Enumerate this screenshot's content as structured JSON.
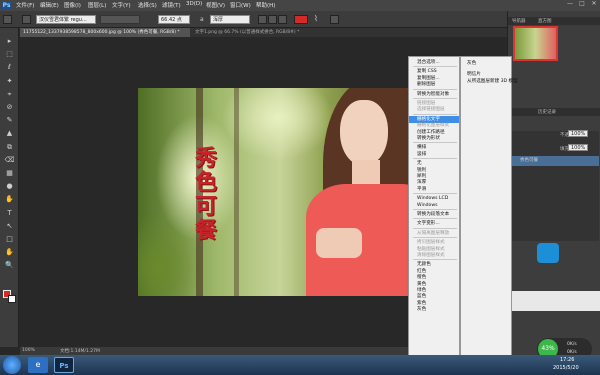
{
  "app": {
    "logo": "Ps"
  },
  "menubar": {
    "items": [
      "文件(F)",
      "编辑(E)",
      "图像(I)",
      "图层(L)",
      "文字(Y)",
      "选择(S)",
      "滤镜(T)",
      "3D(D)",
      "视图(V)",
      "窗口(W)",
      "帮助(H)"
    ]
  },
  "window_controls": {
    "minimize": "—",
    "restore": "□",
    "close": "✕"
  },
  "options": {
    "font_family": "汉仪雪君体繁",
    "font_style": "regu...",
    "font_size": "66.42 点",
    "antialias": "a",
    "antialias_mode": "浑厚",
    "text_color": "#d42a2a"
  },
  "tabs": [
    {
      "label": "11755122_1337938598578_800x600.jpg @ 100% (秀色可餐, RGB/8) *",
      "active": true
    },
    {
      "label": "文字1.png @ 66.7% (以普通样式拼合, RGB/8#) *",
      "active": false
    }
  ],
  "toolbar": {
    "tools": [
      "▸",
      "⬚",
      "ℓ",
      "✦",
      "⌖",
      "⊘",
      "✎",
      "▲",
      "⧉",
      "⌫",
      "▦",
      "●",
      "✋",
      "T",
      "↖",
      "□",
      "✋",
      "🔍"
    ]
  },
  "calligraphy": {
    "text": "秀色可餐"
  },
  "statusbar": {
    "zoom": "100%",
    "doc": "文档:1.14M/1.27M"
  },
  "navigator": {
    "tab1": "导航器",
    "tab2": "直方图"
  },
  "history": {
    "tab1": "历史记录"
  },
  "layers": {
    "opacity_label": "不透明度:",
    "opacity_value": "100%",
    "fill_label": "填充:",
    "fill_value": "100%",
    "rows": [
      "秀色可餐"
    ]
  },
  "context_menu": {
    "items": [
      {
        "label": "混合选项...",
        "disabled": false
      },
      {
        "sep": true
      },
      {
        "label": "复制 CSS",
        "disabled": false
      },
      {
        "label": "复制图层...",
        "disabled": false
      },
      {
        "label": "删除图层",
        "disabled": false
      },
      {
        "sep": true
      },
      {
        "label": "转换为智能对象",
        "disabled": false
      },
      {
        "sep": true
      },
      {
        "label": "链接图层",
        "disabled": true
      },
      {
        "label": "选择链接图层",
        "disabled": true
      },
      {
        "sep": true
      },
      {
        "label": "栅格化文字",
        "disabled": false,
        "highlight": true
      },
      {
        "label": "栅格化图层样式",
        "disabled": true
      },
      {
        "label": "创建工作路径",
        "disabled": false
      },
      {
        "label": "转换为形状",
        "disabled": false
      },
      {
        "sep": true
      },
      {
        "label": "横排",
        "disabled": false
      },
      {
        "label": "竖排",
        "disabled": false
      },
      {
        "sep": true
      },
      {
        "label": "无",
        "disabled": false
      },
      {
        "label": "锐利",
        "disabled": false
      },
      {
        "label": "犀利",
        "disabled": false
      },
      {
        "label": "浑厚",
        "disabled": false
      },
      {
        "label": "平滑",
        "disabled": false
      },
      {
        "sep": true
      },
      {
        "label": "Windows LCD",
        "disabled": false
      },
      {
        "label": "Windows",
        "disabled": false
      },
      {
        "sep": true
      },
      {
        "label": "转换为段落文本",
        "disabled": false
      },
      {
        "sep": true
      },
      {
        "label": "文字变形...",
        "disabled": false
      },
      {
        "sep": true
      },
      {
        "label": "从隔离图层释放",
        "disabled": true
      },
      {
        "sep": true
      },
      {
        "label": "拷贝图层样式",
        "disabled": true
      },
      {
        "label": "粘贴图层样式",
        "disabled": true
      },
      {
        "label": "清除图层样式",
        "disabled": true
      },
      {
        "sep": true
      },
      {
        "label": "无颜色",
        "disabled": false
      },
      {
        "label": "红色",
        "disabled": false
      },
      {
        "label": "橙色",
        "disabled": false
      },
      {
        "label": "黄色",
        "disabled": false
      },
      {
        "label": "绿色",
        "disabled": false
      },
      {
        "label": "蓝色",
        "disabled": false
      },
      {
        "label": "紫色",
        "disabled": false
      },
      {
        "label": "灰色",
        "disabled": false
      }
    ]
  },
  "submenu": {
    "items": [
      "明信片",
      "从所选图层新建 3D 模型"
    ],
    "header": "灰色"
  },
  "taskbar": {
    "time": "17:26",
    "date": "2015/5/20"
  },
  "widget": {
    "percent": "43%",
    "up": "0K/s",
    "down": "0K/s"
  }
}
